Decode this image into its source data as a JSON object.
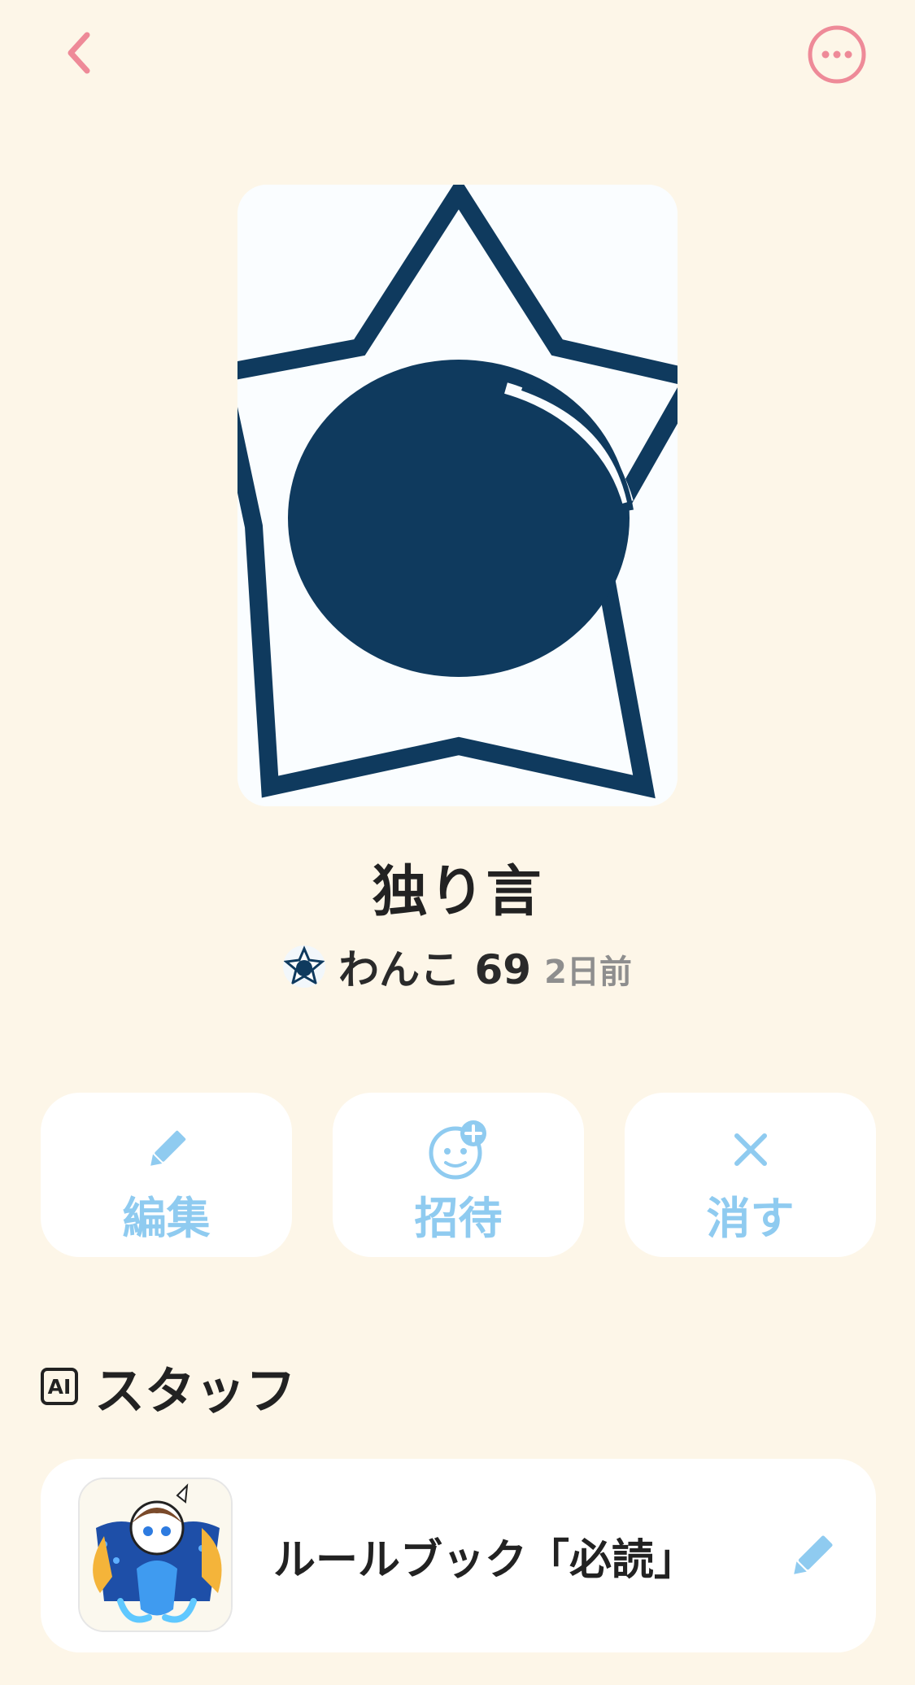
{
  "colors": {
    "background": "#FDF6E8",
    "accent_pink": "#EE8A98",
    "accent_blue": "#8FCBF0",
    "navy": "#0F3A5E"
  },
  "header": {
    "back_icon": "chevron-left-icon",
    "more_icon": "more-horizontal-circle-icon"
  },
  "room": {
    "title": "独り言",
    "author_name": "わんこ 69",
    "posted": "2日前"
  },
  "actions": [
    {
      "label": "編集",
      "icon": "pencil-icon"
    },
    {
      "label": "招待",
      "icon": "add-person-icon"
    },
    {
      "label": "消す",
      "icon": "close-icon"
    }
  ],
  "staff_section": {
    "badge": "AI",
    "title": "スタッフ"
  },
  "staff": [
    {
      "name": "ルールブック「必読」",
      "edit_icon": "pencil-icon"
    }
  ]
}
